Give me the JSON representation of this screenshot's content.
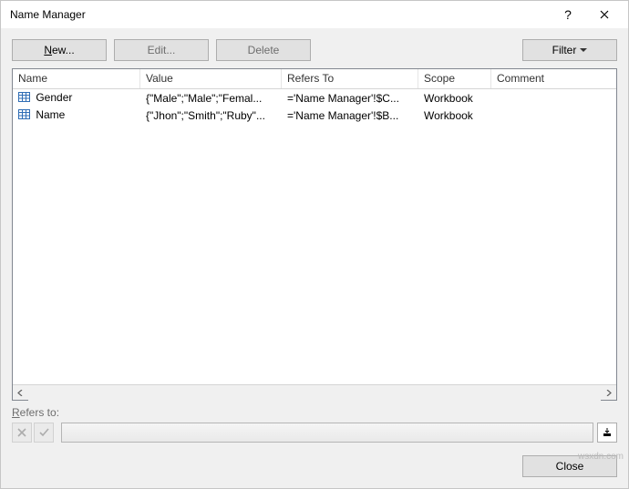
{
  "dialog": {
    "title": "Name Manager"
  },
  "buttons": {
    "new_prefix": "N",
    "new_suffix": "ew...",
    "edit": "Edit...",
    "delete": "Delete",
    "filter": "Filter",
    "close": "Close"
  },
  "columns": {
    "name": "Name",
    "value": "Value",
    "refers": "Refers To",
    "scope": "Scope",
    "comment": "Comment"
  },
  "rows": [
    {
      "name": "Gender",
      "value": "{\"Male\";\"Male\";\"Femal...",
      "refers": "='Name Manager'!$C...",
      "scope": "Workbook",
      "comment": ""
    },
    {
      "name": "Name",
      "value": "{\"Jhon\";\"Smith\";\"Ruby\"...",
      "refers": "='Name Manager'!$B...",
      "scope": "Workbook",
      "comment": ""
    }
  ],
  "refers_section": {
    "label_prefix": "R",
    "label_suffix": "efers to:"
  },
  "watermark": "wsxdn.com"
}
